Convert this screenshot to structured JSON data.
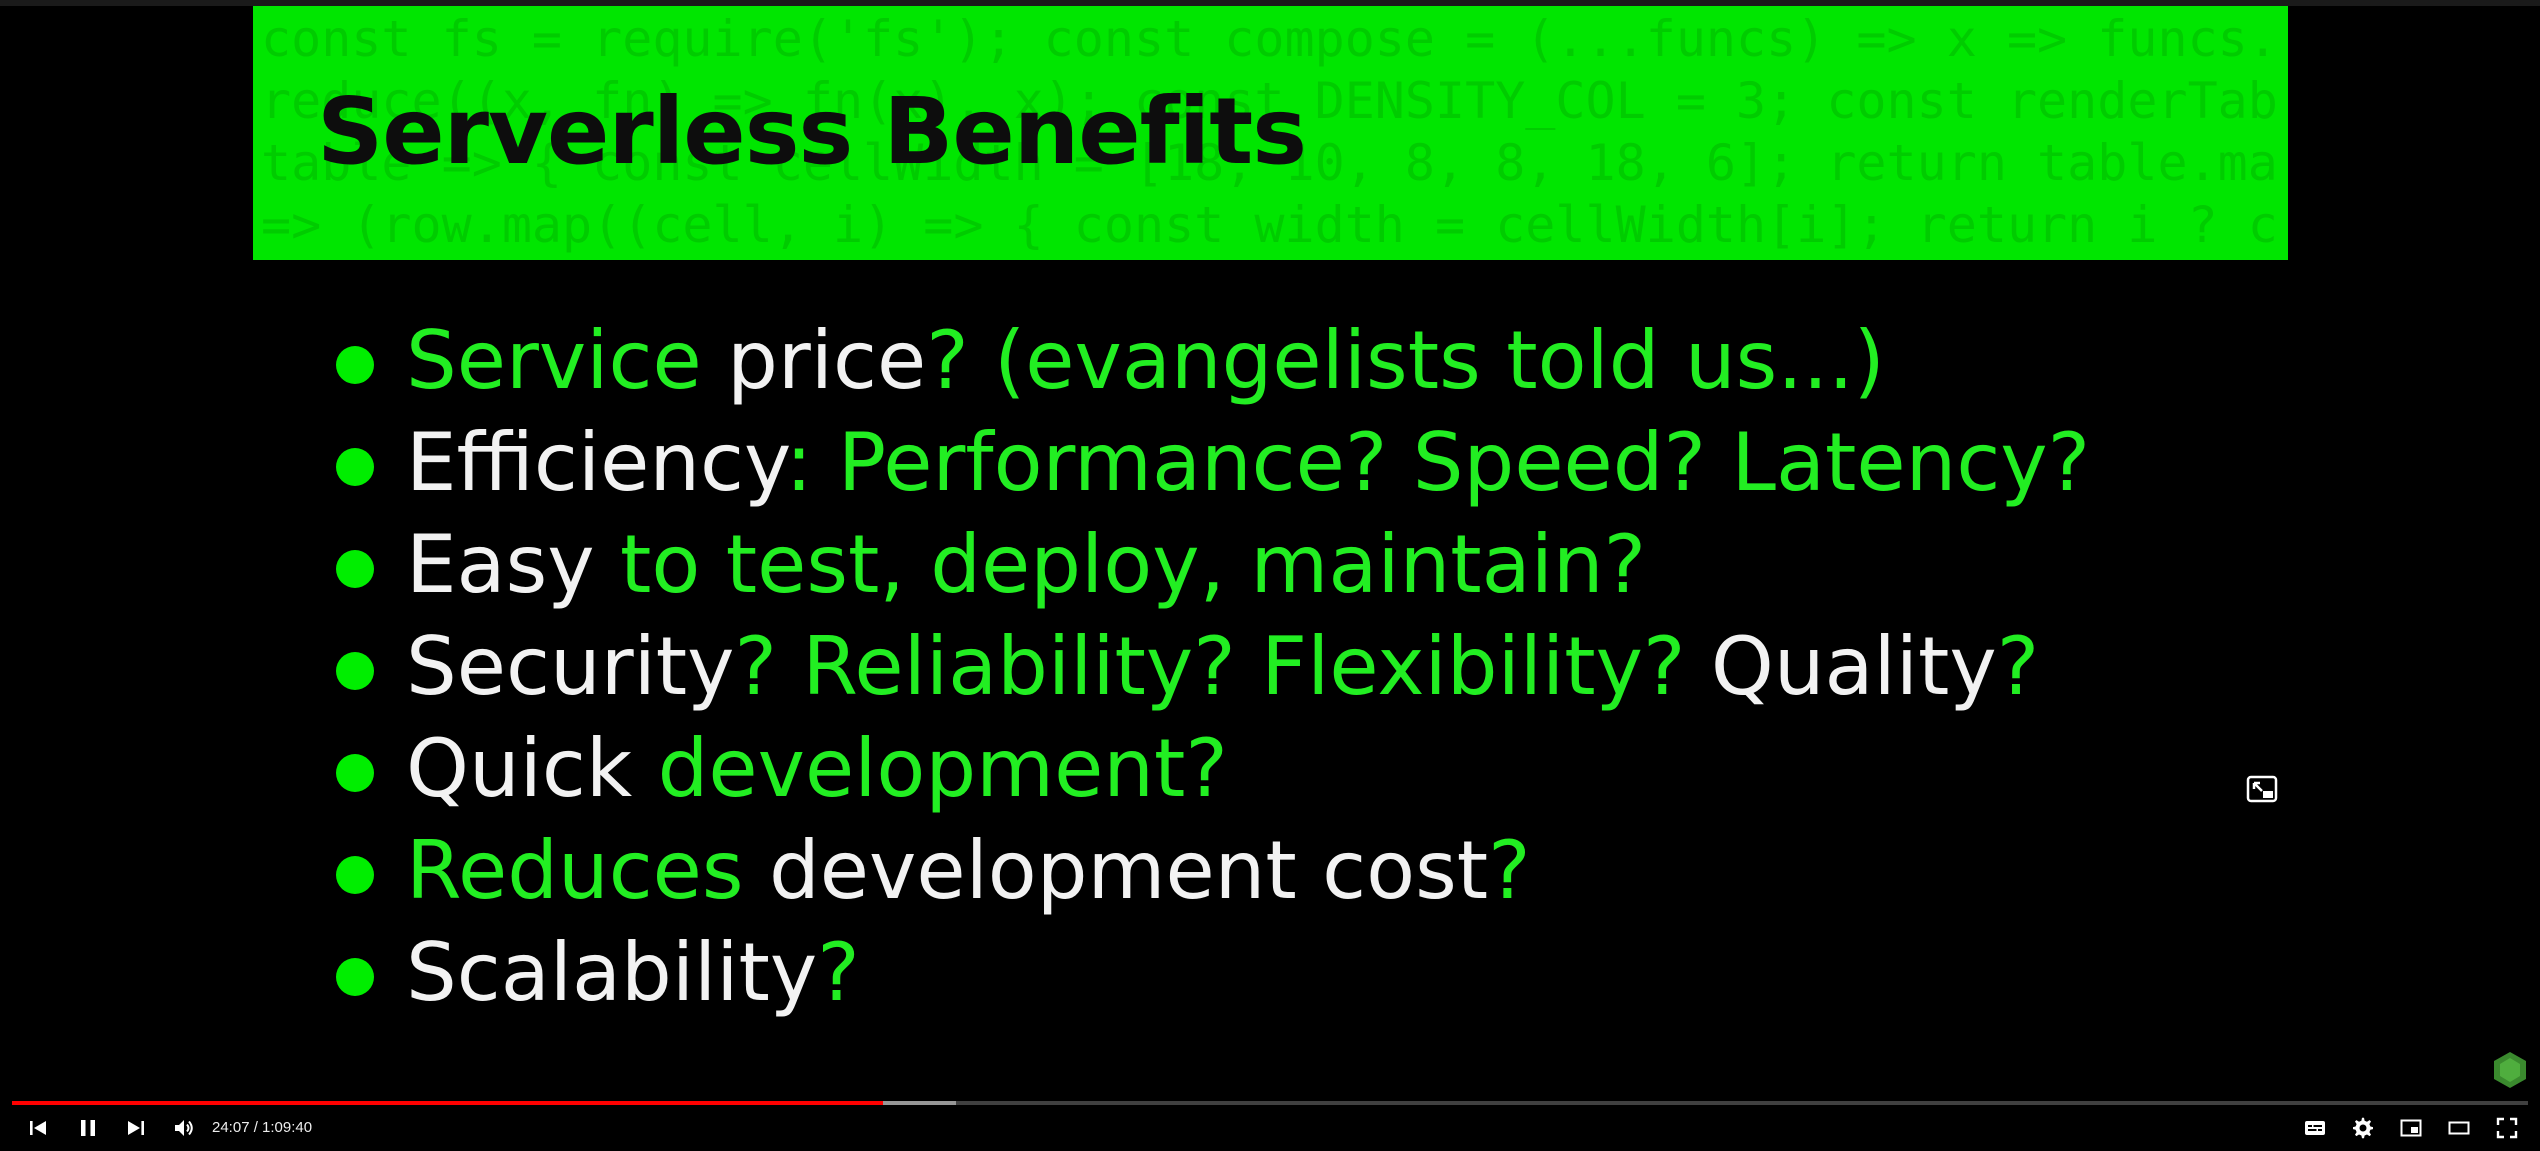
{
  "slide": {
    "header_color": "#00e600",
    "title": "Serverless Benefits",
    "code_background": [
      "const fs = require('fs'); const compose = (...funcs) => x => funcs.",
      "reduce((x, fn) => fn(x), x); const DENSITY_COL = 3; const renderTab",
      "table => { const cellWidth = [18, 10, 8, 8, 18, 6]; return table.ma",
      "=> (row.map((cell, i) => { const width = cellWidth[i]; return i ? c"
    ],
    "bullets": [
      {
        "segments": [
          {
            "text": "Service ",
            "color": "green"
          },
          {
            "text": "price",
            "color": "white"
          },
          {
            "text": "? (evangelists told us...)",
            "color": "green"
          }
        ]
      },
      {
        "segments": [
          {
            "text": "Efficiency",
            "color": "white"
          },
          {
            "text": ": Performance? Speed? Latency?",
            "color": "green"
          }
        ]
      },
      {
        "segments": [
          {
            "text": "Easy ",
            "color": "white"
          },
          {
            "text": "to test, deploy, maintain?",
            "color": "green"
          }
        ]
      },
      {
        "segments": [
          {
            "text": "Security",
            "color": "white"
          },
          {
            "text": "? Reliability? Flexibility? ",
            "color": "green"
          },
          {
            "text": "Quality",
            "color": "white"
          },
          {
            "text": "?",
            "color": "green"
          }
        ]
      },
      {
        "segments": [
          {
            "text": "Quick ",
            "color": "white"
          },
          {
            "text": "development?",
            "color": "green"
          }
        ]
      },
      {
        "segments": [
          {
            "text": "Reduces ",
            "color": "green"
          },
          {
            "text": "development cost",
            "color": "white"
          },
          {
            "text": "?",
            "color": "green"
          }
        ]
      },
      {
        "segments": [
          {
            "text": "Scalability",
            "color": "white"
          },
          {
            "text": "?",
            "color": "green"
          }
        ]
      }
    ]
  },
  "player": {
    "current_time": "24:07",
    "duration": "1:09:40",
    "time_text": "24:07 / 1:09:40",
    "progress_played": 0.346,
    "progress_buffered": 0.375,
    "accent_color": "#ff0000",
    "controls_left": [
      "previous-icon",
      "pause-icon",
      "next-icon",
      "volume-icon"
    ],
    "controls_right": [
      "subtitles-icon",
      "settings-icon",
      "miniplayer-icon",
      "theater-mode-icon",
      "fullscreen-icon"
    ]
  }
}
